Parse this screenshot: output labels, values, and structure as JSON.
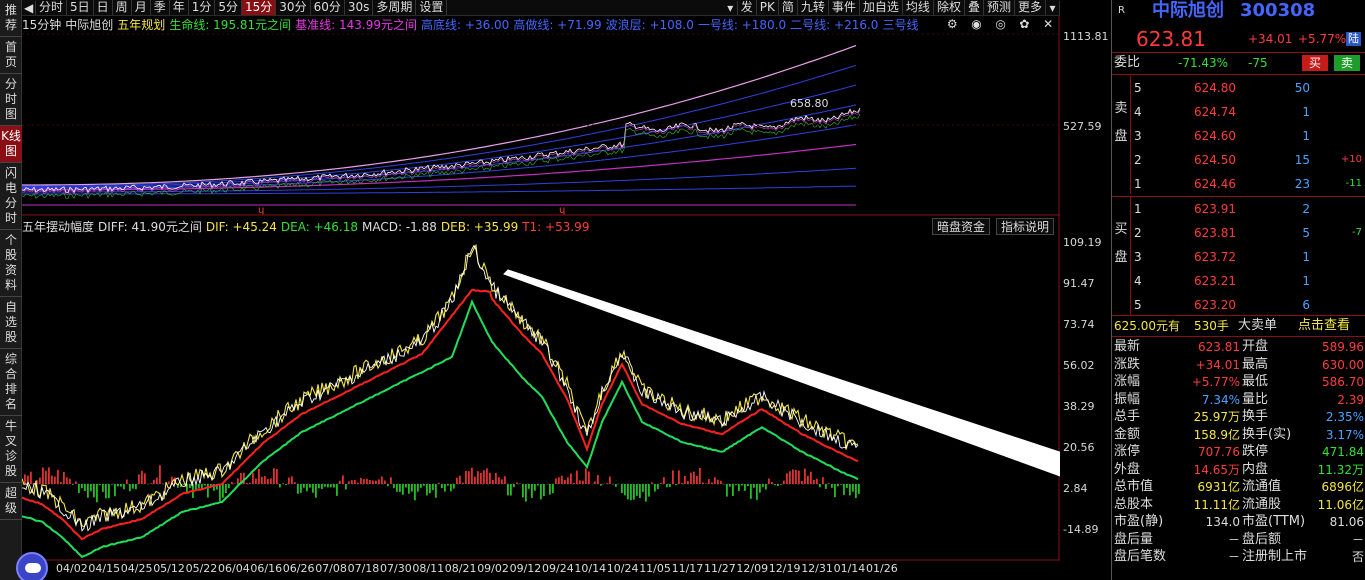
{
  "left_nav": [
    "推荐",
    "首页",
    "分时图",
    "K线图",
    "闪电分时",
    "个股资料",
    "自选股",
    "综合排名",
    "牛叉诊股",
    "超级"
  ],
  "left_nav_active": 3,
  "toolbar": {
    "periods": [
      "分时",
      "5日",
      "日",
      "周",
      "月",
      "季",
      "年",
      "1分",
      "5分",
      "15分",
      "30分",
      "60分",
      "30s",
      "多周期",
      "设置"
    ],
    "active_period": "15分",
    "right_buttons": [
      "发",
      "PK",
      "简",
      "九转",
      "事件",
      "加自选",
      "均线",
      "除权",
      "叠",
      "预测",
      "更多"
    ]
  },
  "main_info": {
    "period": "15分钟",
    "name": "中际旭创",
    "plan": "五年规划",
    "lifeline": "生命线: 195.81元之间",
    "baseline": "基准线: 143.99元之间",
    "items": [
      "高底线: +36.00",
      "高做线: +71.99",
      "波浪层: +108.0",
      "一号线: +180.0",
      "二号线: +216.0",
      "三号线"
    ]
  },
  "upper_axis": {
    "top": "1113.81",
    "mid": "527.59",
    "peak_label": "658.80"
  },
  "sub_info": {
    "title": "五年摆动幅度",
    "diff": "DIFF: 41.90元之间",
    "dif": "DIF: +45.24",
    "dea": "DEA: +46.18",
    "macd": "MACD: -1.88",
    "deb": "DEB: +35.99",
    "t1": "T1: +53.99",
    "btn_funds": "暗盘资金",
    "btn_help": "指标说明"
  },
  "lower_axis": [
    "109.19",
    "91.47",
    "73.74",
    "56.02",
    "38.29",
    "20.56",
    "2.84",
    "-14.89"
  ],
  "dates": [
    "04/02",
    "04/15",
    "04/25",
    "05/12",
    "05/22",
    "06/04",
    "06/16",
    "06/26",
    "07/08",
    "07/18",
    "07/30",
    "08/11",
    "08/21",
    "09/02",
    "09/12",
    "09/24",
    "10/14",
    "10/24",
    "11/05",
    "11/17",
    "11/27",
    "12/09",
    "12/19",
    "12/31",
    "01/14",
    "01/26"
  ],
  "quote": {
    "name": "中际旭创",
    "code": "300308",
    "price": "623.81",
    "change": "+34.01",
    "pct": "+5.77%",
    "market": "陆",
    "weibi_label": "委比",
    "weibi": "-71.43%",
    "weicha": "-75",
    "buy_btn": "买",
    "sell_btn": "卖",
    "sell_label": "卖盘",
    "buy_label": "买盘",
    "asks": [
      {
        "lvl": "5",
        "price": "624.80",
        "vol": "50",
        "chg": ""
      },
      {
        "lvl": "4",
        "price": "624.74",
        "vol": "1",
        "chg": ""
      },
      {
        "lvl": "3",
        "price": "624.60",
        "vol": "1",
        "chg": ""
      },
      {
        "lvl": "2",
        "price": "624.50",
        "vol": "15",
        "chg": "+10"
      },
      {
        "lvl": "1",
        "price": "624.46",
        "vol": "23",
        "chg": "-11"
      }
    ],
    "bids": [
      {
        "lvl": "1",
        "price": "623.91",
        "vol": "2",
        "chg": ""
      },
      {
        "lvl": "2",
        "price": "623.81",
        "vol": "5",
        "chg": "-7"
      },
      {
        "lvl": "3",
        "price": "623.72",
        "vol": "1",
        "chg": ""
      },
      {
        "lvl": "4",
        "price": "623.21",
        "vol": "1",
        "chg": ""
      },
      {
        "lvl": "5",
        "price": "623.20",
        "vol": "6",
        "chg": ""
      }
    ],
    "big_order": {
      "price": "625.00元有",
      "vol": "530手",
      "label": "大卖单",
      "link": "点击查看"
    },
    "stats": [
      [
        "最新",
        "623.81",
        "开盘",
        "589.96"
      ],
      [
        "涨跌",
        "+34.01",
        "最高",
        "630.00"
      ],
      [
        "涨幅",
        "+5.77%",
        "最低",
        "586.70"
      ],
      [
        "振幅",
        "7.34%",
        "量比",
        "2.39"
      ],
      [
        "总手",
        "25.97万",
        "换手",
        "2.35%"
      ],
      [
        "金额",
        "158.9亿",
        "换手(实)",
        "3.17%"
      ],
      [
        "涨停",
        "707.76",
        "跌停",
        "471.84"
      ],
      [
        "外盘",
        "14.65万",
        "内盘",
        "11.32万"
      ],
      [
        "总市值",
        "6931亿",
        "流通值",
        "6896亿"
      ],
      [
        "总股本",
        "11.11亿",
        "流通股",
        "11.06亿"
      ],
      [
        "市盈(静)",
        "134.0",
        "市盈(TTM)",
        "81.06"
      ],
      [
        "盘后量",
        "－",
        "盘后额",
        "－"
      ],
      [
        "盘后笔数",
        "－",
        "注册制上市",
        "否"
      ]
    ]
  },
  "colors": {
    "red": "#ff3b3b",
    "green": "#33e033",
    "yellow": "#f5e642",
    "blue": "#4466ff",
    "magenta": "#e637e6",
    "panel_red": "#8a0f14"
  }
}
